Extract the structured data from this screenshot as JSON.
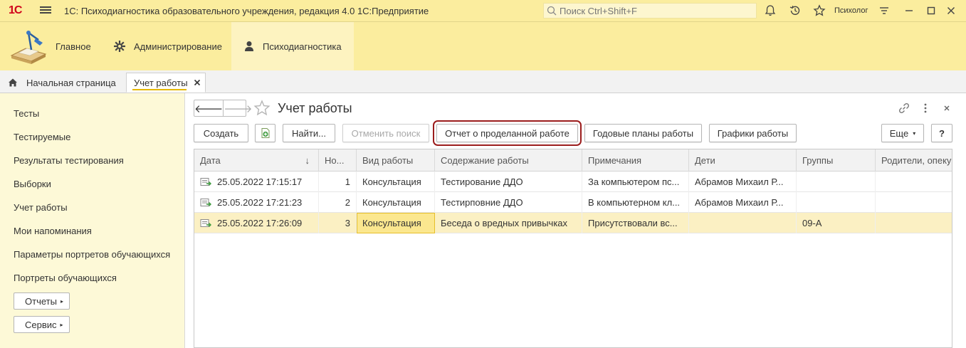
{
  "app": {
    "logo": "1С",
    "title": "1С: Психодиагностика образовательного учреждения, редакция 4.0 1С:Предприятие",
    "search_placeholder": "Поиск Ctrl+Shift+F",
    "user": "Психолог"
  },
  "sections": [
    {
      "label": "Главное",
      "icon": "desk-lamp-icon"
    },
    {
      "label": "Администрирование",
      "icon": "gear-icon"
    },
    {
      "label": "Психодиагностика",
      "icon": "person-icon"
    }
  ],
  "tabs": {
    "home": "Начальная страница",
    "active": "Учет работы"
  },
  "sidebar": {
    "items": [
      "Тесты",
      "Тестируемые",
      "Результаты тестирования",
      "Выборки",
      "Учет работы",
      "Мои напоминания",
      "Параметры портретов обучающихся",
      "Портреты обучающихся"
    ],
    "buttons": [
      "Отчеты",
      "Сервис"
    ]
  },
  "form": {
    "title": "Учет работы",
    "buttons": {
      "create": "Создать",
      "find": "Найти...",
      "cancel_search": "Отменить поиск",
      "report": "Отчет о проделанной работе",
      "annual_plans": "Годовые планы работы",
      "schedules": "Графики работы",
      "more": "Еще",
      "help": "?"
    }
  },
  "table": {
    "columns": [
      "Дата",
      "Но...",
      "Вид работы",
      "Содержание работы",
      "Примечания",
      "Дети",
      "Группы",
      "Родители, опекуны"
    ],
    "sort_indicator": "↓",
    "rows": [
      {
        "date": "25.05.2022 17:15:17",
        "num": "1",
        "type": "Консультация",
        "content": "Тестирование ДДО",
        "notes": "За компьютером пс...",
        "children": "Абрамов Михаил Р...",
        "groups": "",
        "parents": ""
      },
      {
        "date": "25.05.2022 17:21:23",
        "num": "2",
        "type": "Консультация",
        "content": "Тестирповние ДДО",
        "notes": "В компьютерном кл...",
        "children": "Абрамов Михаил Р...",
        "groups": "",
        "parents": ""
      },
      {
        "date": "25.05.2022 17:26:09",
        "num": "3",
        "type": "Консультация",
        "content": "Беседа о вредных привычках",
        "notes": "Присутствовали вс...",
        "children": "",
        "groups": "09-А",
        "parents": ""
      }
    ],
    "selected_row": 2
  },
  "colors": {
    "header_bg": "#fbed9e",
    "sidebar_bg": "#fdf9d7",
    "selected_row": "#fbf0c3",
    "highlight_frame": "#9b1c1c"
  }
}
